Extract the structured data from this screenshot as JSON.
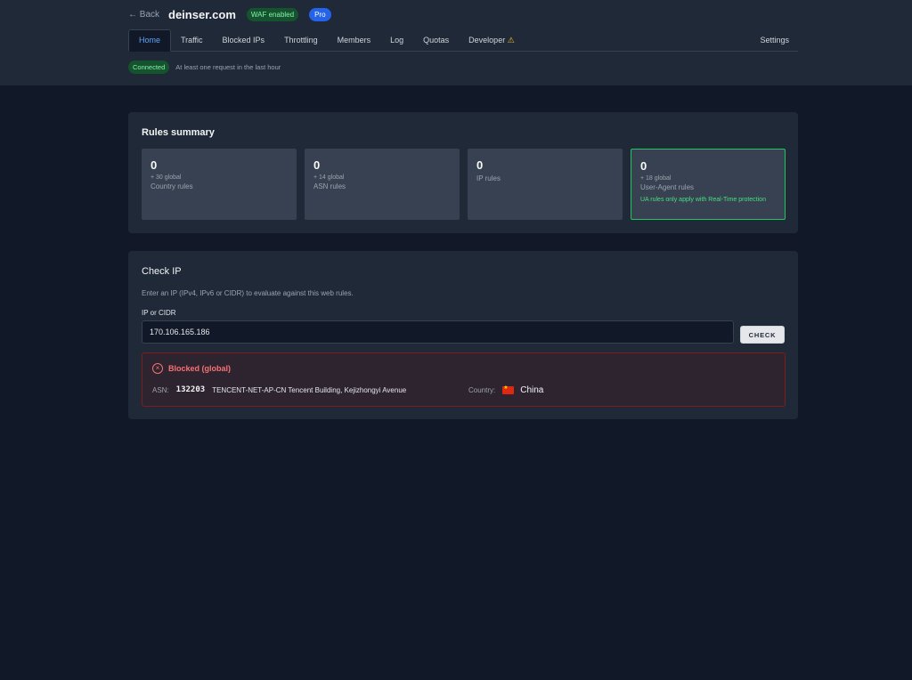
{
  "header": {
    "back_label": "← Back",
    "domain": "deinser.com",
    "waf_badge": "WAF enabled",
    "plan_badge": "Pro"
  },
  "tabs": [
    {
      "label": "Home",
      "active": true
    },
    {
      "label": "Traffic"
    },
    {
      "label": "Blocked IPs"
    },
    {
      "label": "Throttling"
    },
    {
      "label": "Members"
    },
    {
      "label": "Log"
    },
    {
      "label": "Quotas"
    },
    {
      "label": "Developer",
      "icon": "warning-icon",
      "icon_glyph": "⚠"
    },
    {
      "label": "Settings"
    }
  ],
  "status": {
    "badge": "Connected",
    "text": "At least one request in the last hour"
  },
  "rules_summary": {
    "title": "Rules summary",
    "stats": [
      {
        "count": "0",
        "global": "+ 30 global",
        "label": "Country rules"
      },
      {
        "count": "0",
        "global": "+ 14 global",
        "label": "ASN rules"
      },
      {
        "count": "0",
        "global": "",
        "label": "IP rules"
      },
      {
        "count": "0",
        "global": "+ 18 global",
        "label": "User-Agent rules",
        "note": "UA rules only apply with Real-Time protection"
      }
    ]
  },
  "check_ip": {
    "title": "Check IP",
    "description": "Enter an IP (IPv4, IPv6 or CIDR) to evaluate against this web rules.",
    "field_label": "IP or CIDR",
    "input_value": "170.106.165.186",
    "button_label": "CHECK",
    "result": {
      "status": "Blocked (global)",
      "asn_label": "ASN:",
      "asn_number": "132203",
      "asn_org": "TENCENT-NET-AP-CN Tencent Building, Kejizhongyi Avenue",
      "country_label": "Country:",
      "country": "China"
    }
  },
  "colors": {
    "accent": "#60a5fa",
    "success": "#4ade80",
    "danger": "#f87171",
    "background": "#111827",
    "panel": "#1f2937"
  }
}
